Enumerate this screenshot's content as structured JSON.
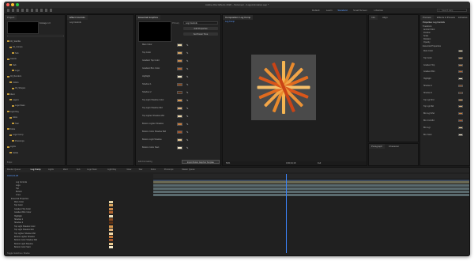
{
  "window": {
    "title": "Adobe After Effects 2020 - /Volumes/.../LogoAnimation.aep *",
    "traffic_lights": [
      "#ff5f57",
      "#febc2e",
      "#28c840"
    ]
  },
  "toolbar": {
    "workspaces": [
      "Default",
      "Learn",
      "Standard",
      "Small Screen",
      "Libraries"
    ],
    "active_workspace": "Standard",
    "search_label": "Search Help"
  },
  "project_panel": {
    "tab": "Project",
    "preview_name": "Footage 1.0",
    "tree": [
      "00_Startfile",
      "01_Comps",
      "Sub",
      "Assets",
      "Sub",
      "Logo",
      "02_Renders",
      "Colors",
      "03_Shapes",
      "Ident",
      "Layers",
      "Logo Stars",
      "Light Ray",
      "Glow",
      "Star",
      "Kicks",
      "Logo Comp",
      "Precomps",
      "Lights",
      "Solids"
    ],
    "footer": "8 bpc"
  },
  "effect_controls": {
    "tab": "Effect Controls",
    "layer_name": "Log Controls",
    "essential_tab": "Essential Graphics",
    "primary_label": "Primary",
    "comp_label": "Log Controls",
    "add_props_button": "Add Properties",
    "set_poster_button": "Set Poster Time",
    "properties": [
      {
        "label": "Main Color",
        "color": "#e8d7a8"
      },
      {
        "label": "Top Color",
        "color": "#d9a55f"
      },
      {
        "label": "Gradient Top Color",
        "color": "#c9884a"
      },
      {
        "label": "Gradient Btm Color",
        "color": "#b5652f"
      },
      {
        "label": "Highlight",
        "color": "#efe3c0"
      },
      {
        "label": "Shadow 1",
        "color": "#8a4a1f"
      },
      {
        "label": "Shadow 2",
        "color": "#5a2f14"
      },
      {
        "label": "Top Light Shadow Color",
        "color": "#d6944a"
      },
      {
        "label": "Top Light Shadow Mid",
        "color": "#e0b27a"
      },
      {
        "label": "Top Lighter Shadow Mid",
        "color": "#f1d9a8"
      },
      {
        "label": "Bottom Lighter Shadow",
        "color": "#c77a3a"
      },
      {
        "label": "Bottom Color Shadow Mid",
        "color": "#a5552b"
      },
      {
        "label": "Bottom Light Shadow",
        "color": "#e9c98f"
      },
      {
        "label": "Bottom Color Start",
        "color": "#f5e8c8"
      }
    ],
    "export_button": "Export Motion Graphics Template",
    "footer": "Edit Formatting"
  },
  "composition": {
    "tab": "Composition: Log Comp",
    "breadcrumb": "Log Comp",
    "zoom": "50%",
    "quality": "Full",
    "timecode": "0;00;04;18",
    "rays": [
      {
        "angle": 0,
        "color": "#f4b552"
      },
      {
        "angle": 22,
        "color": "#e98a2c"
      },
      {
        "angle": 45,
        "color": "#f2a548"
      },
      {
        "angle": 67,
        "color": "#e06b1f"
      },
      {
        "angle": 90,
        "color": "#f6c06a"
      },
      {
        "angle": 112,
        "color": "#d9561a"
      },
      {
        "angle": 135,
        "color": "#eb9336"
      },
      {
        "angle": 157,
        "color": "#c94416"
      }
    ]
  },
  "right_panels": {
    "info_tab": "Info",
    "align_tab": "Align",
    "preview_tab": "Preview",
    "effects_tab": "Effects & Presets",
    "libraries_tab": "Libraries",
    "properties_header": "Properties: Log Controls",
    "transform": "Transform",
    "transform_rows": [
      "Anchor Point",
      "Position",
      "Scale",
      "Rotation",
      "Opacity"
    ],
    "essential_header": "Essential Properties",
    "colors": [
      {
        "label": "Main Color",
        "color": "#e8d7a8"
      },
      {
        "label": "Top Color",
        "color": "#d9a55f"
      },
      {
        "label": "Gradient Top",
        "color": "#c9884a"
      },
      {
        "label": "Gradient Btm",
        "color": "#b5652f"
      },
      {
        "label": "Highlight",
        "color": "#efe3c0"
      },
      {
        "label": "Shadow 1",
        "color": "#8a4a1f"
      },
      {
        "label": "Shadow 2",
        "color": "#5a2f14"
      },
      {
        "label": "Top Lgt Shd",
        "color": "#d6944a"
      },
      {
        "label": "Top Lgt Mid",
        "color": "#e0b27a"
      },
      {
        "label": "Btm Lgt Shd",
        "color": "#c77a3a"
      },
      {
        "label": "Btm Col Mid",
        "color": "#a5552b"
      },
      {
        "label": "Btm Lgt",
        "color": "#e9c98f"
      },
      {
        "label": "Btm Start",
        "color": "#f5e8c8"
      }
    ],
    "paragraph_tab": "Paragraph",
    "character_tab": "Character"
  },
  "timeline": {
    "tabs": [
      "Render Queue",
      "Log Comp",
      "Lights",
      "Ident",
      "Sub",
      "Logo Stars",
      "Light Ray",
      "Glow",
      "Star",
      "Kicks",
      "Precomps",
      "Master Queue"
    ],
    "active_tab": "Log Comp",
    "timecode": "0;00;04;18",
    "layers": [
      "Log Controls",
      "Logo",
      "Top",
      "Bottom",
      "Lines"
    ],
    "effect_header": "Essential Properties",
    "effect_rows": [
      {
        "label": "Main Color",
        "color": "#e8d7a8"
      },
      {
        "label": "Top Color",
        "color": "#d9a55f"
      },
      {
        "label": "Gradient Top Color",
        "color": "#c9884a"
      },
      {
        "label": "Gradient Btm Color",
        "color": "#b5652f"
      },
      {
        "label": "Highlight",
        "color": "#efe3c0"
      },
      {
        "label": "Shadow 1",
        "color": "#8a4a1f"
      },
      {
        "label": "Shadow 2",
        "color": "#5a2f14"
      },
      {
        "label": "Top Light Shadow Color",
        "color": "#d6944a"
      },
      {
        "label": "Top Light Shadow Mid",
        "color": "#e0b27a"
      },
      {
        "label": "Top Lighter Shadow Mid",
        "color": "#f1d9a8"
      },
      {
        "label": "Bottom Lighter Shadow",
        "color": "#c77a3a"
      },
      {
        "label": "Bottom Color Shadow Mid",
        "color": "#a5552b"
      },
      {
        "label": "Bottom Light Shadow",
        "color": "#e9c98f"
      },
      {
        "label": "Bottom Color Start",
        "color": "#f5e8c8"
      }
    ],
    "footer": "Toggle Switches / Modes"
  }
}
